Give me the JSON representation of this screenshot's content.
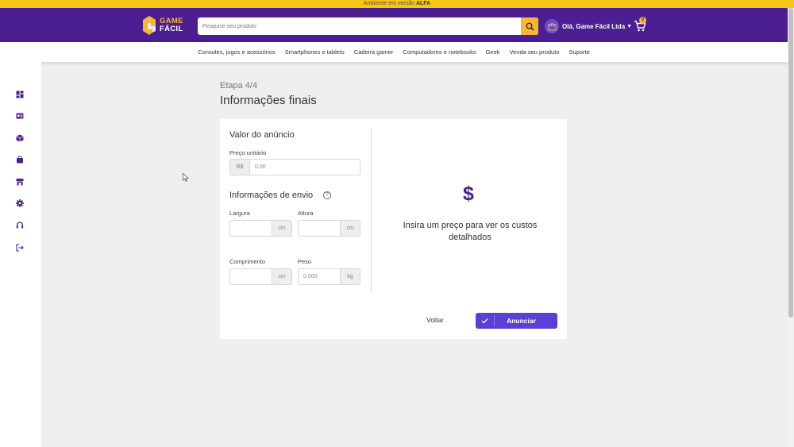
{
  "banner": {
    "text": "Ambiente em versão",
    "highlight": "ALFA"
  },
  "header": {
    "logo_line1": "GAME",
    "logo_line2": "FÁCIL",
    "search_placeholder": "Pesquise seu produto",
    "user_greeting": "Olá, Game Fácil Ltda",
    "cart_count": "0"
  },
  "nav": {
    "items": [
      "Consoles, jogos e acessórios",
      "Smartphones e tablets",
      "Cadeira gamer",
      "Computadores e notebooks",
      "Geek",
      "Venda seu produto",
      "Suporte"
    ]
  },
  "sidebar": {
    "icons": [
      "dashboard-icon",
      "profile-card-icon",
      "box-icon",
      "shopping-bag-icon",
      "store-icon",
      "settings-icon",
      "headset-icon",
      "logout-icon"
    ]
  },
  "page": {
    "step": "Etapa 4/4",
    "title": "Informações finais"
  },
  "form": {
    "price_section": "Valor do anúncio",
    "unit_price_label": "Preço unitário",
    "currency_prefix": "R$",
    "unit_price_placeholder": "0,00",
    "shipping_section": "Informações de envio",
    "width_label": "Largura",
    "height_label": "Altura",
    "length_label": "Comprimento",
    "weight_label": "Peso",
    "unit_cm": "cm",
    "unit_kg": "kg",
    "weight_placeholder": "0,000"
  },
  "summary": {
    "symbol": "$",
    "hint": "Insira um preço para ver os custos detalhados"
  },
  "actions": {
    "back": "Voltar",
    "submit": "Anunciar"
  },
  "colors": {
    "brand_purple": "#4b1f91",
    "accent_yellow": "#f5b82e",
    "button_purple": "#5b3fd6"
  }
}
